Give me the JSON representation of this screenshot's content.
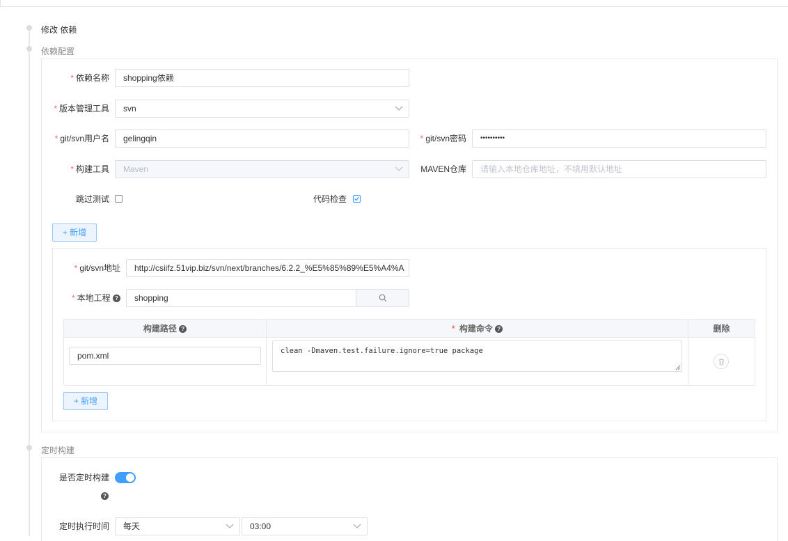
{
  "steps": {
    "edit_title": "修改 依赖",
    "dep_config": "依赖配置",
    "schedule": "定时构建"
  },
  "form": {
    "dep_name_label": "依赖名称",
    "dep_name_value": "shopping依赖",
    "vcs_label": "版本管理工具",
    "vcs_value": "svn",
    "user_label": "git/svn用户名",
    "user_value": "gelingqin",
    "pwd_label": "git/svn密码",
    "pwd_value": "••••••••••",
    "build_tool_label": "构建工具",
    "build_tool_value": "Maven",
    "maven_repo_label": "MAVEN仓库",
    "maven_repo_placeholder": "请输入本地仓库地址，不填用默认地址",
    "skip_test_label": "跳过测试",
    "skip_test_checked": false,
    "code_check_label": "代码检查",
    "code_check_checked": true,
    "add_label": "新增"
  },
  "repo": {
    "addr_label": "git/svn地址",
    "addr_value": "http://csiifz.51vip.biz/svn/next/branches/6.2.2_%E5%85%89%E5%A4%A",
    "project_label": "本地工程",
    "project_value": "shopping",
    "table": {
      "headers": [
        "构建路径",
        "构建命令",
        "删除"
      ],
      "rows": [
        {
          "path": "pom.xml",
          "command": "clean  -Dmaven.test.failure.ignore=true package"
        }
      ]
    },
    "add_label": "新增"
  },
  "schedule": {
    "enable_label": "是否定时构建",
    "enabled": true,
    "time_label": "定时执行时间",
    "freq_value": "每天",
    "time_value": "03:00"
  },
  "colors": {
    "accent": "#409eff",
    "required": "#f56c6c",
    "border": "#dcdfe6"
  }
}
